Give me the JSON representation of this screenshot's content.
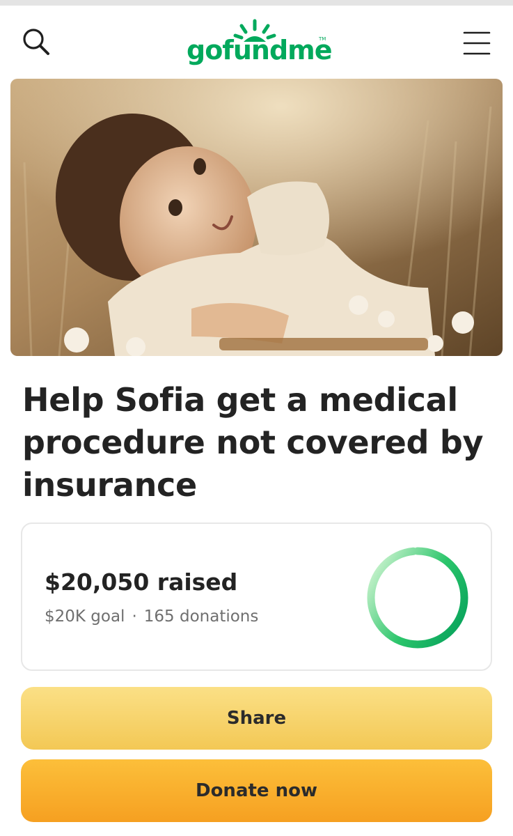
{
  "header": {
    "logo_text": "gofundme",
    "logo_trademark": "TM",
    "search_icon": "search-icon",
    "menu_icon": "hamburger-menu-icon"
  },
  "hero": {
    "image": "photo of a smiling toddler lying in a field of wildflowers"
  },
  "campaign": {
    "title": "Help Sofia get a medical procedure not covered by insurance"
  },
  "progress": {
    "raised": "$20,050 raised",
    "goal": "$20K goal",
    "separator": "·",
    "donations": "165 donations",
    "fraction": 1.0
  },
  "actions": {
    "share_label": "Share",
    "donate_label": "Donate now"
  },
  "colors": {
    "brand_green": "#02a95c",
    "share_yellow": "#f7d46b",
    "donate_orange": "#f9ae2d",
    "ring_light": "#b9f0c0",
    "ring_dark": "#0aa860"
  }
}
